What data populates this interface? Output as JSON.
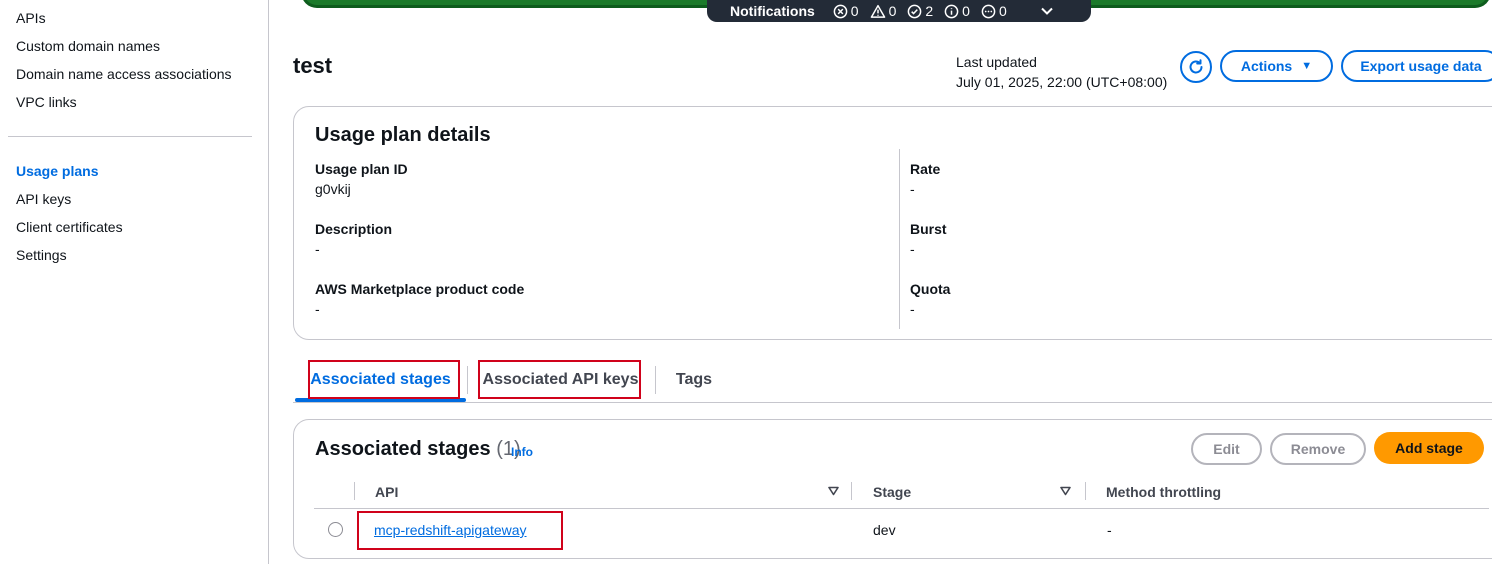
{
  "sidebar": {
    "items": [
      {
        "label": "APIs"
      },
      {
        "label": "Custom domain names"
      },
      {
        "label": "Domain name access associations"
      },
      {
        "label": "VPC links"
      }
    ],
    "items2": [
      {
        "label": "Usage plans",
        "active": true
      },
      {
        "label": "API keys"
      },
      {
        "label": "Client certificates"
      },
      {
        "label": "Settings"
      }
    ]
  },
  "notifications": {
    "label": "Notifications",
    "error_count": "0",
    "warning_count": "0",
    "success_count": "2",
    "info_count": "0",
    "progress_count": "0"
  },
  "header": {
    "title": "test",
    "last_updated_label": "Last updated",
    "last_updated_value": "July 01, 2025, 22:00 (UTC+08:00)",
    "actions_label": "Actions",
    "export_label": "Export usage data"
  },
  "details": {
    "title": "Usage plan details",
    "left": [
      {
        "label": "Usage plan ID",
        "value": "g0vkij"
      },
      {
        "label": "Description",
        "value": "-"
      },
      {
        "label": "AWS Marketplace product code",
        "value": "-"
      }
    ],
    "right": [
      {
        "label": "Rate",
        "value": "-"
      },
      {
        "label": "Burst",
        "value": "-"
      },
      {
        "label": "Quota",
        "value": "-"
      }
    ]
  },
  "tabs": [
    {
      "label": "Associated stages",
      "active": true
    },
    {
      "label": "Associated API keys"
    },
    {
      "label": "Tags"
    }
  ],
  "stages": {
    "title": "Associated stages",
    "count": "(1)",
    "info": "Info",
    "edit_label": "Edit",
    "remove_label": "Remove",
    "add_label": "Add stage",
    "columns": [
      "API",
      "Stage",
      "Method throttling"
    ],
    "rows": [
      {
        "api": "mcp-redshift-apigateway",
        "stage": "dev",
        "throttling": "-"
      }
    ]
  },
  "colors": {
    "accent": "#006ce0",
    "primary_button": "#ff9900",
    "highlight": "#d0021b",
    "flash_success": "#1b7a2a"
  }
}
